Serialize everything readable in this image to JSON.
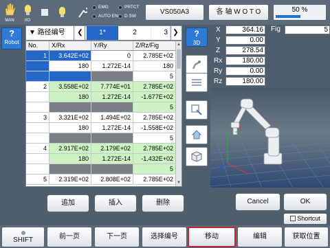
{
  "topbar": {
    "hand_label": "MAN",
    "io_label": "I/O",
    "emg_label": "EMG",
    "auto_en_label": "AUTO EN",
    "prtct_label": "PRTCT",
    "d_sw_label": "D SW",
    "model_button": "VS050A3",
    "axis_button": "各 轴  W O T O",
    "speed_text": "50 %",
    "speed_percent": 50
  },
  "sidebar": {
    "robot_label": "Robot",
    "robot_icon": "?"
  },
  "route_tab": {
    "label": "▼ 路径编号"
  },
  "page_tabs": [
    {
      "label": "1*",
      "active": true
    },
    {
      "label": "2",
      "active": false
    },
    {
      "label": "3",
      "active": false
    }
  ],
  "grid": {
    "headers": [
      "No.",
      "X/Rx",
      "Y/Ry",
      "Z/Rz/Fig"
    ],
    "rows": [
      {
        "no": "1",
        "selected": true,
        "lines": [
          [
            "3.642E+02",
            "0",
            "2.785E+02"
          ],
          [
            "180",
            "1.272E-14",
            "180"
          ],
          [
            "",
            "",
            "5"
          ]
        ]
      },
      {
        "no": "2",
        "selected": false,
        "green": true,
        "lines": [
          [
            "3.558E+02",
            "7.774E+01",
            "2.785E+02"
          ],
          [
            "180",
            "1.272E-14",
            "-1.677E+02"
          ],
          [
            "",
            "",
            "5"
          ]
        ]
      },
      {
        "no": "3",
        "selected": false,
        "green": false,
        "lines": [
          [
            "3.321E+02",
            "1.494E+02",
            "2.785E+02"
          ],
          [
            "180",
            "1.272E-14",
            "-1.558E+02"
          ],
          [
            "",
            "",
            "5"
          ]
        ]
      },
      {
        "no": "4",
        "selected": false,
        "green": true,
        "lines": [
          [
            "2.917E+02",
            "2.179E+02",
            "2.785E+02"
          ],
          [
            "180",
            "1.272E-14",
            "-1.432E+02"
          ],
          [
            "",
            "",
            "5"
          ]
        ]
      },
      {
        "no": "5",
        "selected": false,
        "green": false,
        "lines": [
          [
            "2.319E+02",
            "2.808E+02",
            "2.785E+02"
          ]
        ]
      }
    ]
  },
  "tools": {
    "view3d_label": "3D",
    "view3d_icon": "?"
  },
  "coords": {
    "fig_label": "Fig",
    "fig_value": "5",
    "items": [
      {
        "label": "X",
        "value": "364.16"
      },
      {
        "label": "Y",
        "value": "0.00"
      },
      {
        "label": "Z",
        "value": "278.54"
      },
      {
        "label": "Rx",
        "value": "180.00"
      },
      {
        "label": "Ry",
        "value": "0.00"
      },
      {
        "label": "Rz",
        "value": "180.00"
      }
    ]
  },
  "actions": {
    "add": "追加",
    "insert": "插入",
    "delete": "删除",
    "cancel": "Cancel",
    "ok": "OK",
    "shortcut": "Shortcut"
  },
  "bottom": {
    "shift": "SHIFT",
    "prev": "前一页",
    "next": "下一页",
    "select_no": "选择编号",
    "move": "移动",
    "edit": "编辑",
    "get_pos": "获取位置"
  },
  "colors": {
    "selected_blue": "#2566c9",
    "green_row": "#cdf3c4",
    "gray_row": "#7a7f86",
    "accent_red": "#c0272d"
  }
}
